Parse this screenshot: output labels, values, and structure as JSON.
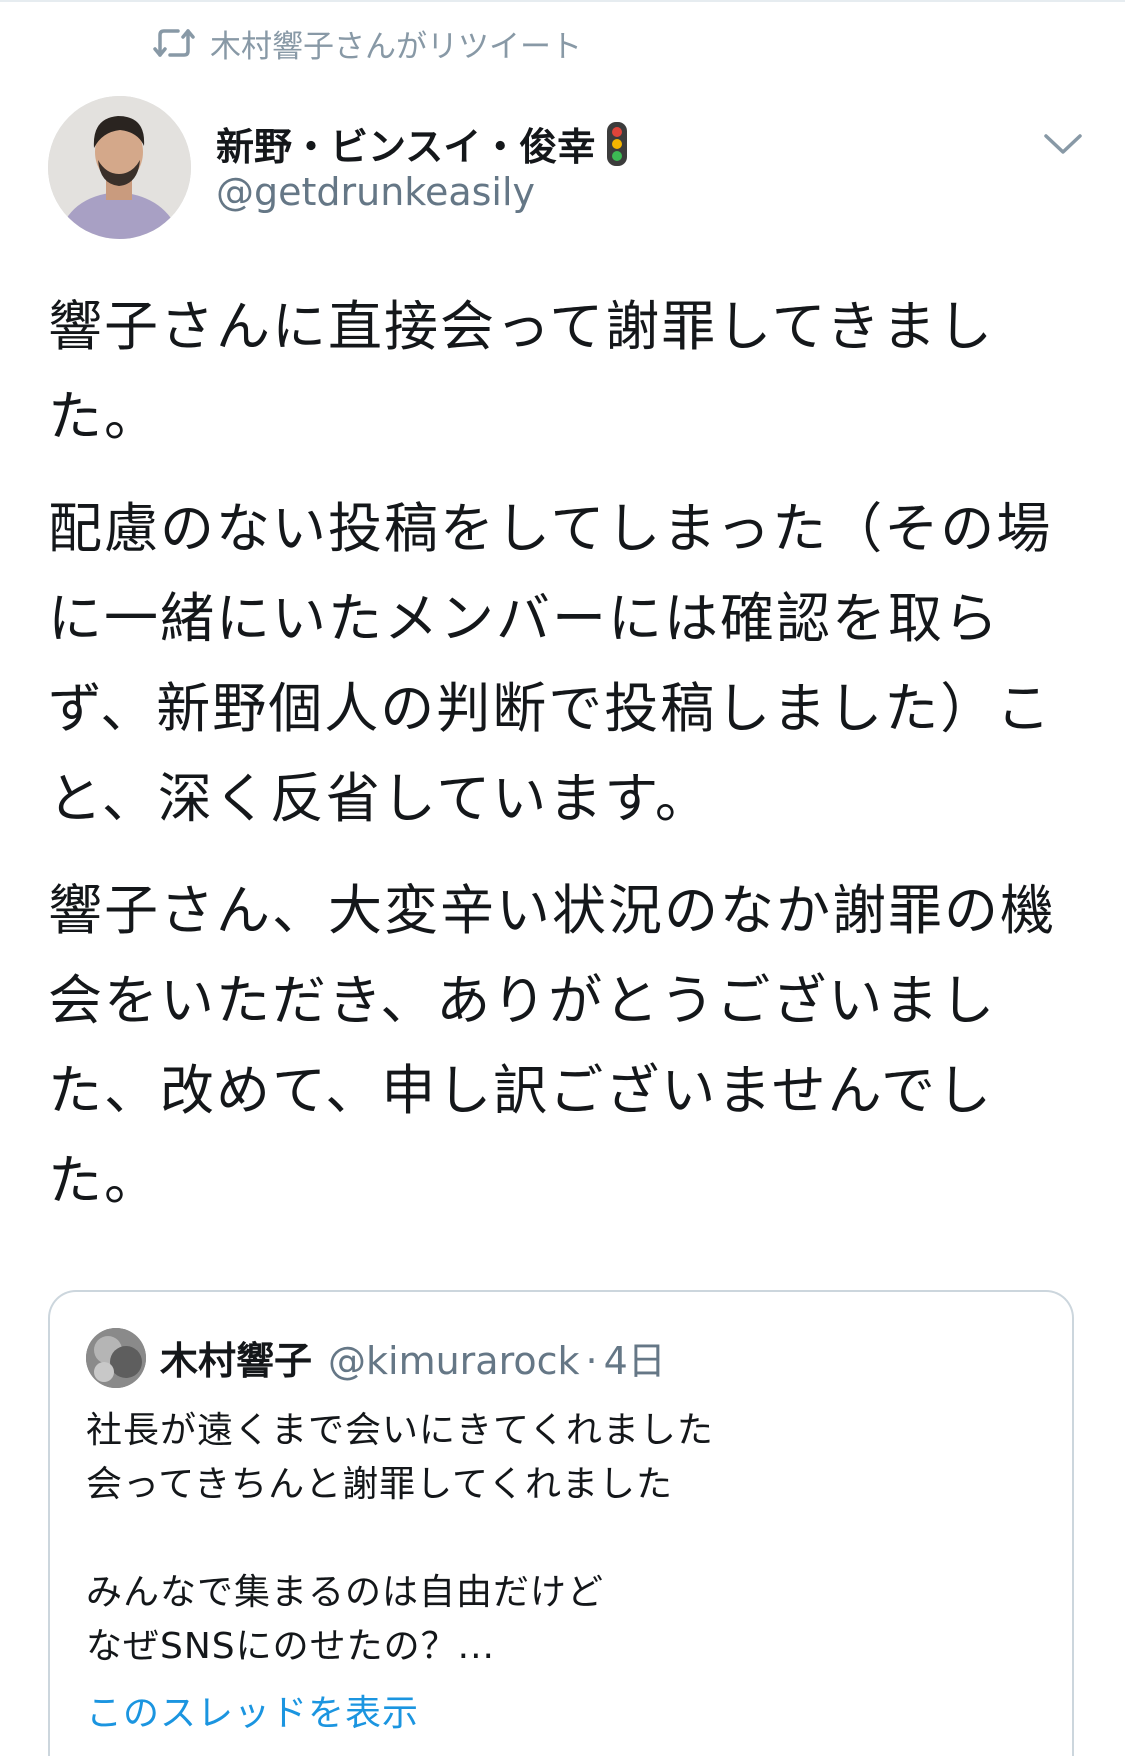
{
  "retweet_context": {
    "icon": "retweet-icon",
    "text": "木村響子さんがリツイート"
  },
  "tweet": {
    "author": {
      "display_name": "新野・ビンスイ・俊幸",
      "emoji": "traffic-light-icon",
      "handle": "@getdrunkeasily"
    },
    "menu_icon": "chevron-down-icon",
    "paragraphs": [
      "響子さんに直接会って謝罪してきました。",
      "配慮のない投稿をしてしまった（その場に一緒にいたメンバーには確認を取らず、新野個人の判断で投稿しました）こと、深く反省しています。",
      "響子さん、大変辛い状況のなか謝罪の機会をいただき、ありがとうございました、改めて、申し訳ございませんでした。"
    ]
  },
  "quoted_tweet": {
    "author": {
      "display_name": "木村響子",
      "handle": "@kimurarock",
      "separator": "·",
      "time": "4日"
    },
    "lines": [
      "社長が遠くまで会いにきてくれました",
      "会ってきちんと謝罪してくれました",
      "",
      "みんなで集まるのは自由だけど",
      "なぜSNSにのせたの？..."
    ],
    "show_thread_label": "このスレッドを表示"
  },
  "colors": {
    "text_primary": "#14171a",
    "text_secondary": "#657786",
    "retweet_gray": "#8899a6",
    "link_blue": "#1b95e0",
    "border": "#ccd6dd"
  }
}
